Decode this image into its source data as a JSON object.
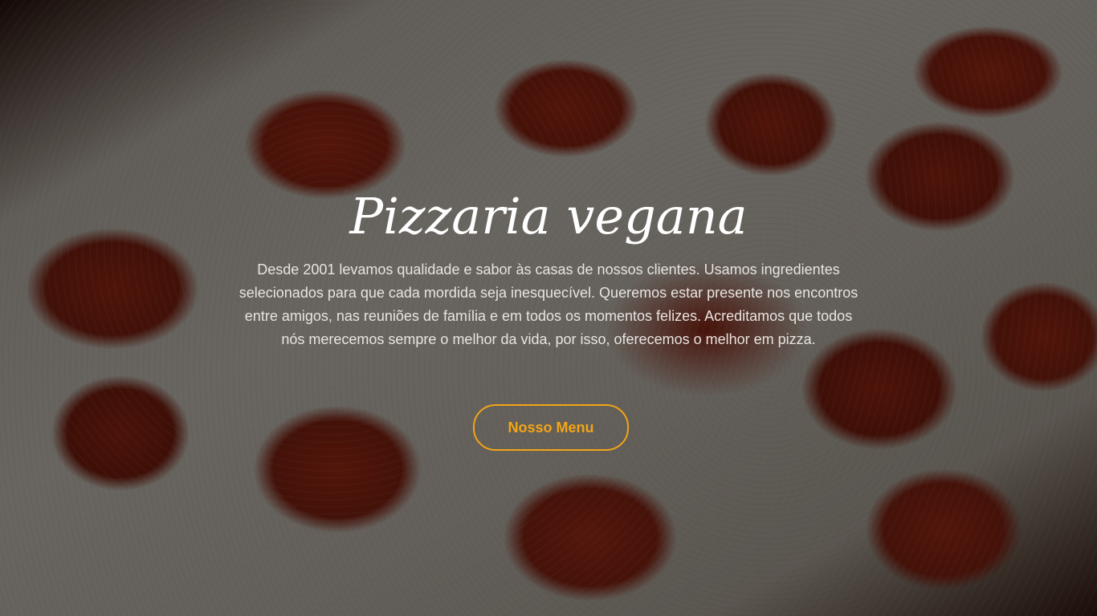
{
  "hero": {
    "title": "Pizzaria vegana",
    "description": "Desde 2001 levamos qualidade e sabor às casas de nossos clientes. Usamos ingredientes selecionados para que cada mordida seja inesquecível. Queremos estar presente nos encontros entre amigos, nas reuniões de família e em todos os momentos felizes. Acreditamos que todos nós merecemos sempre o melhor da vida, por isso, oferecemos o melhor em pizza.",
    "button_label": "Nosso Menu"
  },
  "colors": {
    "accent": "#f2a516",
    "text": "#ffffff"
  }
}
